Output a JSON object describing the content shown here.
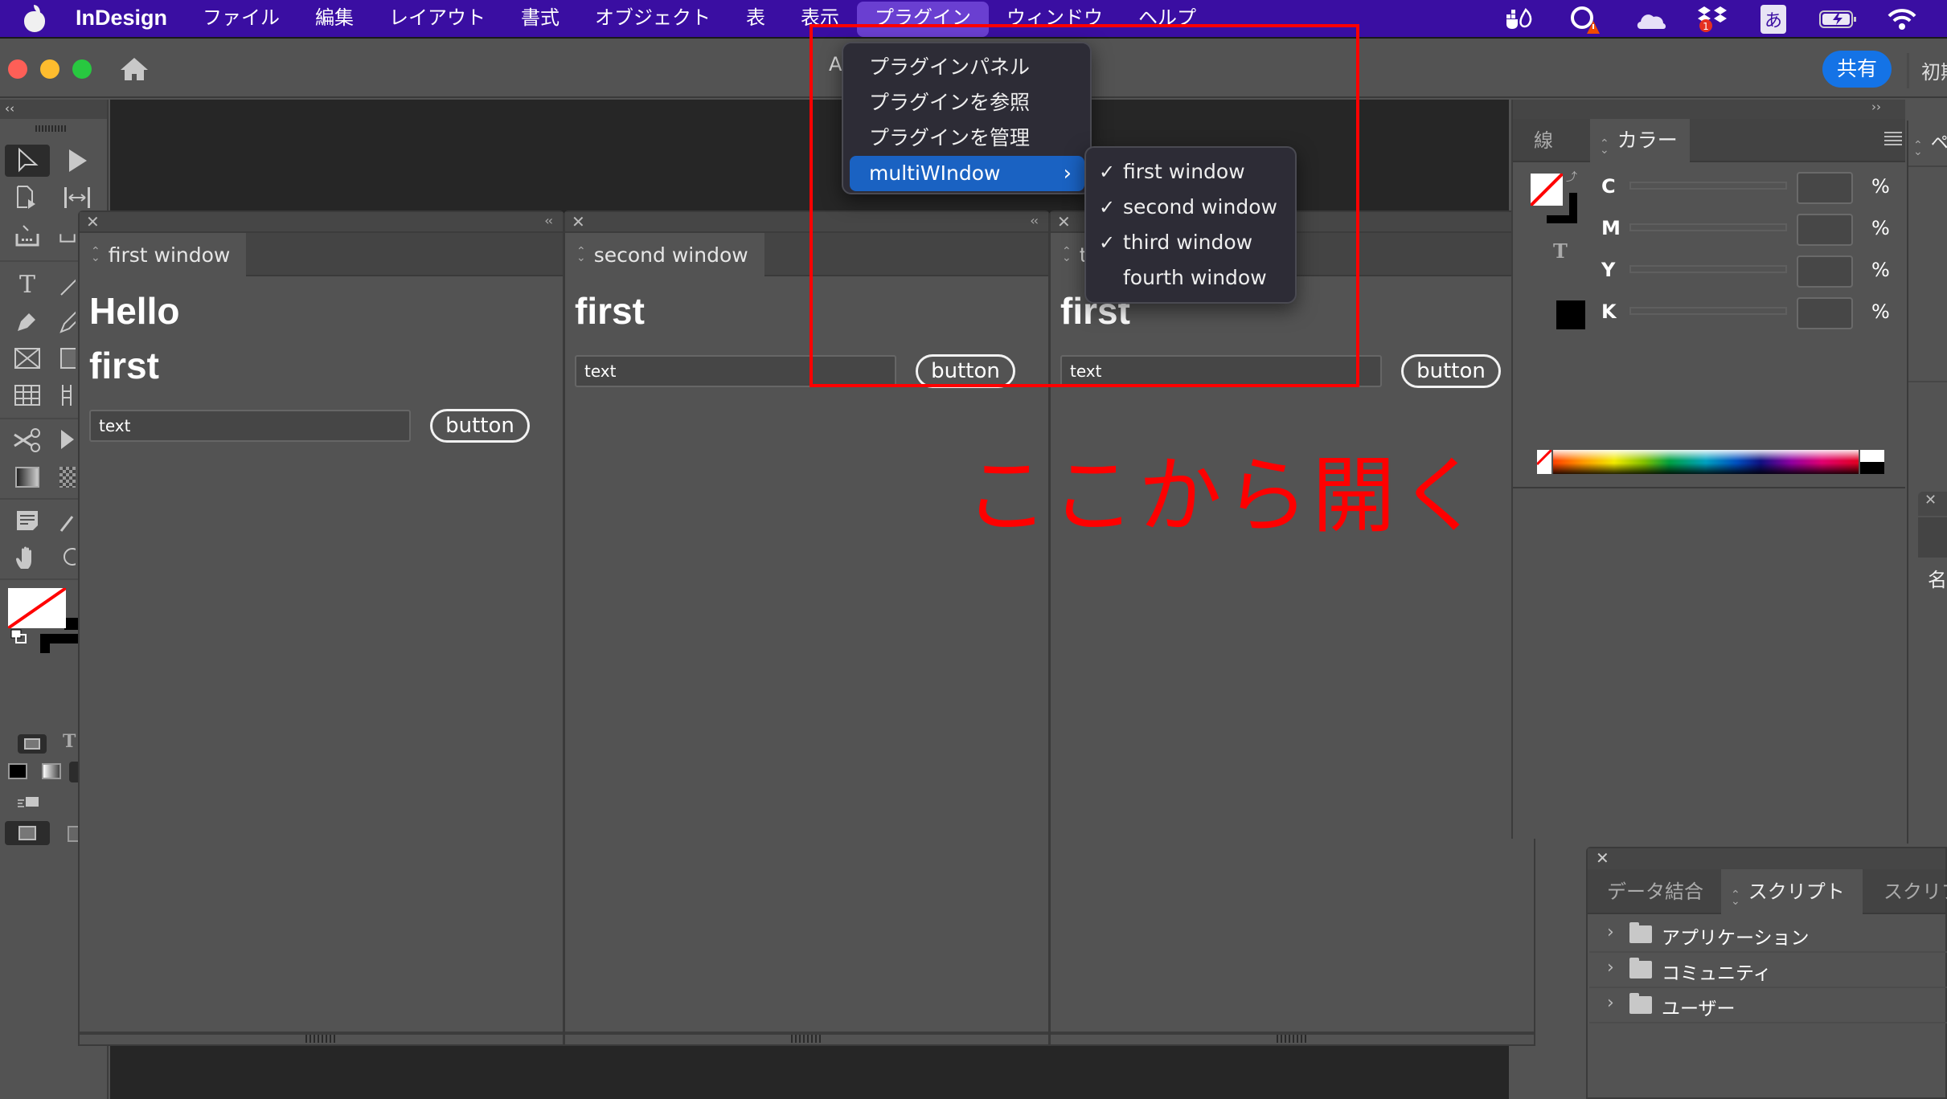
{
  "menubar": {
    "app_name": "InDesign",
    "items": [
      "ファイル",
      "編集",
      "レイアウト",
      "書式",
      "オブジェクト",
      "表",
      "表示",
      "プラグイン",
      "ウィンドウ",
      "ヘルプ"
    ],
    "active_item": "プラグイン",
    "status_icons": [
      "docker-icon",
      "creative-cloud-warning-icon",
      "onedrive-icon",
      "dropbox-icon",
      "input-method-icon",
      "battery-icon",
      "wifi-icon"
    ],
    "dropbox_badge": "1",
    "input_method_label": "あ"
  },
  "titlebar": {
    "doc_title_partial": "A",
    "share_label": "共有",
    "workspace_partial": "初期"
  },
  "plugin_menu": {
    "items": [
      "プラグインパネル",
      "プラグインを参照",
      "プラグインを管理",
      "multiWIndow"
    ],
    "highlighted": "multiWIndow",
    "submenu": [
      {
        "label": "first window",
        "checked": true
      },
      {
        "label": "second window",
        "checked": true
      },
      {
        "label": "third window",
        "checked": true
      },
      {
        "label": "fourth window",
        "checked": false
      }
    ],
    "check_glyph": "✓",
    "arrow_glyph": "›"
  },
  "panels": [
    {
      "tab": "first window",
      "headings": [
        "Hello",
        "first"
      ],
      "input_value": "text",
      "button": "button"
    },
    {
      "tab": "second window",
      "headings": [
        "first"
      ],
      "input_value": "text",
      "button": "button"
    },
    {
      "tab": "third window",
      "tab_visible": "t",
      "headings": [
        "first"
      ],
      "input_value": "text",
      "button": "button"
    }
  ],
  "annotation": {
    "text": "ここから開く",
    "color": "#ff0000"
  },
  "color_panel": {
    "tabs": [
      "線",
      "カラー"
    ],
    "active_tab": "カラー",
    "channels": [
      {
        "label": "C",
        "value": "",
        "unit": "%"
      },
      {
        "label": "M",
        "value": "",
        "unit": "%"
      },
      {
        "label": "Y",
        "value": "",
        "unit": "%"
      },
      {
        "label": "K",
        "value": "",
        "unit": "%"
      }
    ],
    "collapse": "››"
  },
  "far_right_panel": {
    "tab_partial": "ペ",
    "label_partial": "名"
  },
  "scripts_panel": {
    "tabs": [
      "データ結合",
      "スクリプト",
      "スクリプ"
    ],
    "active_tab": "スクリプト",
    "folders": [
      "アプリケーション",
      "コミュニティ",
      "ユーザー"
    ]
  },
  "toolbar": {
    "collapse": "‹‹"
  },
  "colors": {
    "menubar": "#3a0ea2",
    "accent": "#1473e6",
    "menu_highlight": "#1a62c2",
    "annotation": "#ff0000"
  }
}
